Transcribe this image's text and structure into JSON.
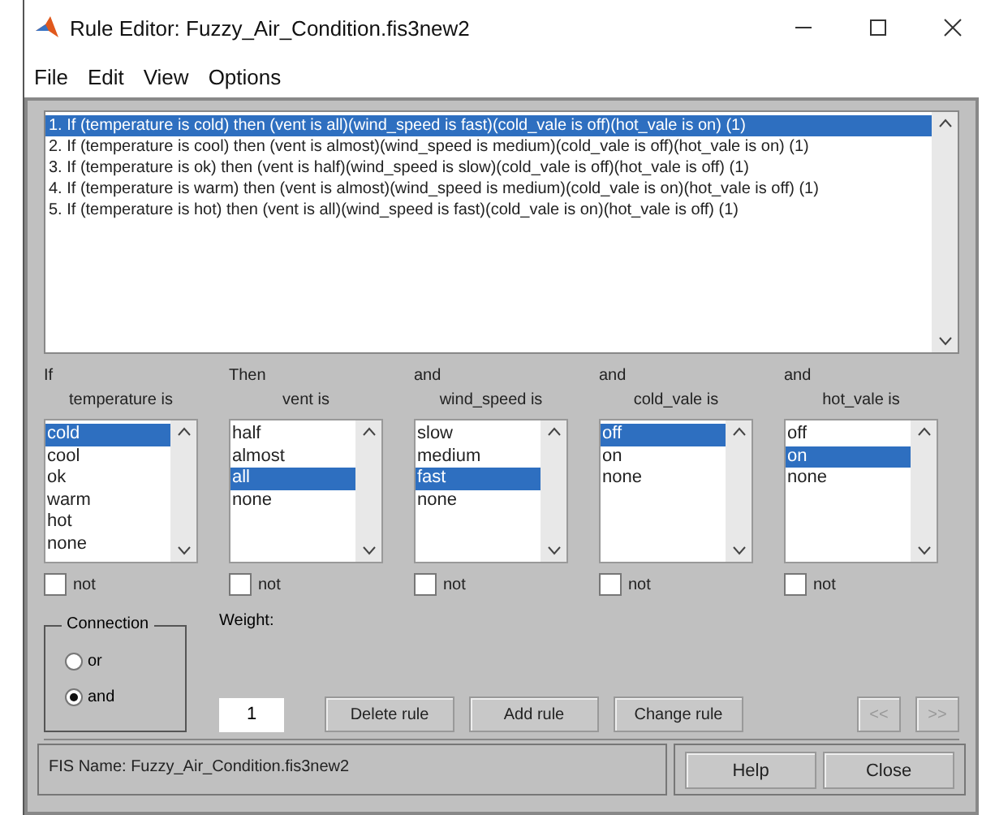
{
  "window": {
    "title": "Rule Editor: Fuzzy_Air_Condition.fis3new2"
  },
  "menu": [
    "File",
    "Edit",
    "View",
    "Options"
  ],
  "rules": [
    {
      "text": "1. If (temperature is cold) then (vent is all)(wind_speed is fast)(cold_vale is off)(hot_vale is on) (1)",
      "selected": true
    },
    {
      "text": "2. If (temperature is cool) then (vent is almost)(wind_speed is medium)(cold_vale is off)(hot_vale is on) (1)",
      "selected": false
    },
    {
      "text": "3. If (temperature is ok) then (vent is half)(wind_speed is slow)(cold_vale is off)(hot_vale is off) (1)",
      "selected": false
    },
    {
      "text": "4. If (temperature is warm) then (vent is almost)(wind_speed is medium)(cold_vale is on)(hot_vale is off) (1)",
      "selected": false
    },
    {
      "text": "5. If (temperature is hot) then (vent is all)(wind_speed is fast)(cold_vale is on)(hot_vale is off) (1)",
      "selected": false
    }
  ],
  "columns": [
    {
      "prefix": "If",
      "label": "temperature is",
      "options": [
        {
          "label": "cold",
          "selected": true
        },
        {
          "label": "cool",
          "selected": false
        },
        {
          "label": "ok",
          "selected": false
        },
        {
          "label": "warm",
          "selected": false
        },
        {
          "label": "hot",
          "selected": false
        },
        {
          "label": "none",
          "selected": false
        }
      ],
      "not": {
        "label": "not",
        "checked": false
      }
    },
    {
      "prefix": "Then",
      "label": "vent is",
      "options": [
        {
          "label": "half",
          "selected": false
        },
        {
          "label": "almost",
          "selected": false
        },
        {
          "label": "all",
          "selected": true
        },
        {
          "label": "none",
          "selected": false
        }
      ],
      "not": {
        "label": "not",
        "checked": false
      }
    },
    {
      "prefix": "and",
      "label": "wind_speed is",
      "options": [
        {
          "label": "slow",
          "selected": false
        },
        {
          "label": "medium",
          "selected": false
        },
        {
          "label": "fast",
          "selected": true
        },
        {
          "label": "none",
          "selected": false
        }
      ],
      "not": {
        "label": "not",
        "checked": false
      }
    },
    {
      "prefix": "and",
      "label": "cold_vale is",
      "options": [
        {
          "label": "off",
          "selected": true
        },
        {
          "label": "on",
          "selected": false
        },
        {
          "label": "none",
          "selected": false
        }
      ],
      "not": {
        "label": "not",
        "checked": false
      }
    },
    {
      "prefix": "and",
      "label": "hot_vale is",
      "options": [
        {
          "label": "off",
          "selected": false
        },
        {
          "label": "on",
          "selected": true
        },
        {
          "label": "none",
          "selected": false
        }
      ],
      "not": {
        "label": "not",
        "checked": false
      }
    }
  ],
  "connection": {
    "title": "Connection",
    "options": [
      {
        "label": "or",
        "selected": false
      },
      {
        "label": "and",
        "selected": true
      }
    ]
  },
  "weight": {
    "label": "Weight:",
    "value": "1"
  },
  "buttons": [
    {
      "label": "Delete rule",
      "disabled": false
    },
    {
      "label": "Add rule",
      "disabled": false
    },
    {
      "label": "Change rule",
      "disabled": false
    }
  ],
  "nav_buttons": [
    {
      "label": "<<",
      "disabled": true
    },
    {
      "label": ">>",
      "disabled": true
    }
  ],
  "status_bar": {
    "text": "FIS Name: Fuzzy_Air_Condition.fis3new2",
    "buttons": [
      "Help",
      "Close"
    ]
  }
}
